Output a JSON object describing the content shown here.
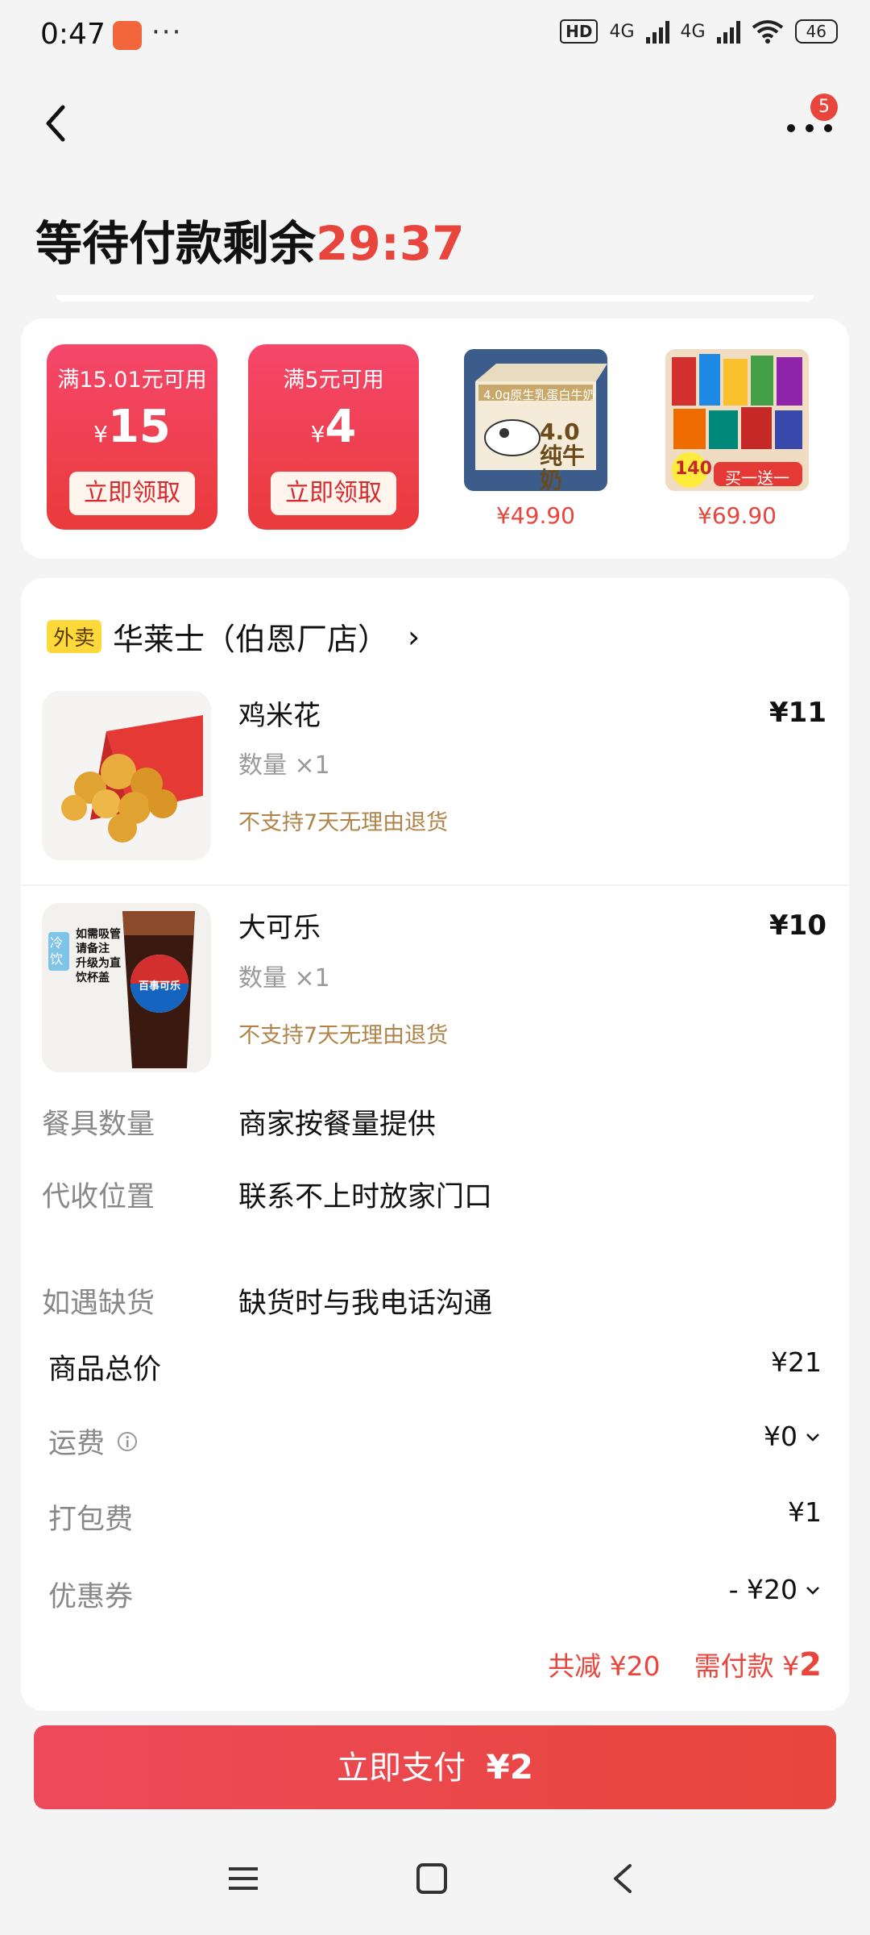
{
  "status": {
    "time": "0:47",
    "dots": "···",
    "hd": "HD",
    "net1": "4G",
    "net2": "4G",
    "battery": "46"
  },
  "nav": {
    "back_icon": "chevron-left-icon",
    "more_icon": "more-icon",
    "badge": "5"
  },
  "header": {
    "title_prefix": "等待付款剩余",
    "countdown": "29:37"
  },
  "promos": {
    "coupons": [
      {
        "condition": "满15.01元可用",
        "currency": "¥",
        "amount": "15",
        "button": "立即领取"
      },
      {
        "condition": "满5元可用",
        "currency": "¥",
        "amount": "4",
        "button": "立即领取"
      }
    ],
    "products": [
      {
        "price": "¥49.90",
        "label_top": "4.0g原生乳蛋白牛奶",
        "label_main": "4.0纯牛奶"
      },
      {
        "price": "¥69.90",
        "label_badge": "140",
        "label_bottom": "买一送一"
      }
    ]
  },
  "shop": {
    "tag": "外卖",
    "name": "华莱士（伯恩厂店）",
    "chevron": "›"
  },
  "items": [
    {
      "name": "鸡米花",
      "qty": "数量 ×1",
      "note": "不支持7天无理由退货",
      "price": "¥11"
    },
    {
      "name": "大可乐",
      "qty": "数量 ×1",
      "note": "不支持7天无理由退货",
      "price": "¥10",
      "tag": "冷饮",
      "cup_text": "百事可乐",
      "side_text": "如需吸管请备注 升级为直饮杯盖"
    }
  ],
  "info": [
    {
      "label": "餐具数量",
      "value": "商家按餐量提供"
    },
    {
      "label": "代收位置",
      "value": "联系不上时放家门口"
    },
    {
      "label": "如遇缺货",
      "value": "缺货时与我电话沟通"
    }
  ],
  "summary": [
    {
      "label": "商品总价",
      "value": "¥21"
    },
    {
      "label": "运费",
      "value": "¥0"
    },
    {
      "label": "打包费",
      "value": "¥1"
    },
    {
      "label": "优惠券",
      "value": "- ¥20"
    }
  ],
  "totals": {
    "discount_label": "共减",
    "discount_value": "¥20",
    "pay_label": "需付款",
    "pay_currency": "¥",
    "pay_value": "2"
  },
  "pay_button": {
    "label": "立即支付",
    "amount": "¥2"
  },
  "colors": {
    "accent": "#e8453c",
    "coupon": "#f5476a",
    "note": "#b08348",
    "tag": "#ffd83a"
  }
}
